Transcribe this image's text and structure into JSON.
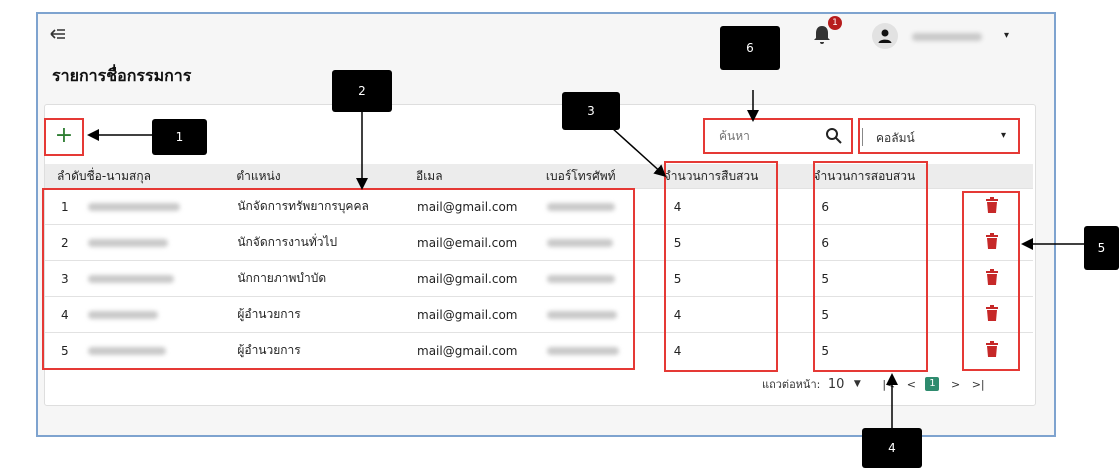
{
  "header": {
    "collapse_icon": "collapse-sidebar-icon",
    "notification_count": "1",
    "user_caret": "▾"
  },
  "page": {
    "title": "รายการชื่อกรรมการ"
  },
  "toolbar": {
    "add_label": "+",
    "search_placeholder": "ค้นหา",
    "column_label": "คอลัมน์",
    "column_caret": "▾"
  },
  "table": {
    "headers": [
      "ลำดับ",
      "ชื่อ-นามสกุล",
      "ตำแหน่ง",
      "อีเมล",
      "เบอร์โทรศัพท์",
      "จำนวนการสืบสวน",
      "จำนวนการสอบสวน"
    ],
    "rows": [
      {
        "no": "1",
        "position": "นักจัดการทรัพยากรบุคคล",
        "email": "mail@gmail.com",
        "investigations": "4",
        "inquiries": "6"
      },
      {
        "no": "2",
        "position": "นักจัดการงานทั่วไป",
        "email": "mail@email.com",
        "investigations": "5",
        "inquiries": "6"
      },
      {
        "no": "3",
        "position": "นักกายภาพบำบัด",
        "email": "mail@gmail.com",
        "investigations": "5",
        "inquiries": "5"
      },
      {
        "no": "4",
        "position": "ผู้อำนวยการ",
        "email": "mail@gmail.com",
        "investigations": "4",
        "inquiries": "5"
      },
      {
        "no": "5",
        "position": "ผู้อำนวยการ",
        "email": "mail@gmail.com",
        "investigations": "4",
        "inquiries": "5"
      }
    ]
  },
  "pager": {
    "rows_per_page_label": "แถวต่อหน้า:",
    "rows_per_page_value": "10",
    "first": "|<",
    "prev": "<",
    "current_page": "1",
    "next": ">",
    "last": ">|"
  },
  "callouts": [
    "1",
    "2",
    "3",
    "4",
    "5",
    "6"
  ],
  "colors": {
    "highlight": "#e53935",
    "add_icon": "#2e7d32",
    "delete_icon": "#c62828",
    "link": "#1a3c8f",
    "page_active": "#2e8b6e"
  }
}
